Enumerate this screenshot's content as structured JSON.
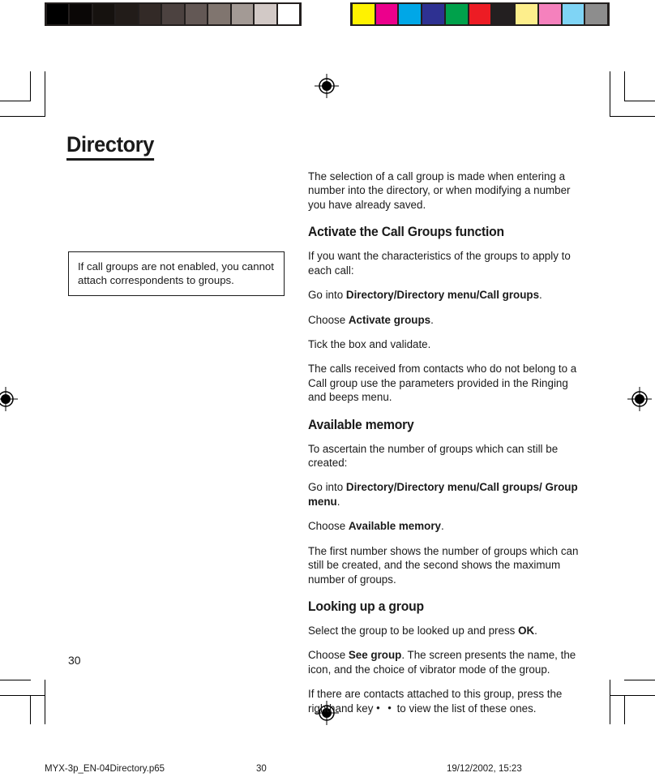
{
  "document": {
    "title": "Directory",
    "page_number": "30"
  },
  "calibration": {
    "grayscale_label": "grayscale-calibration-bar",
    "color_label": "color-calibration-bar",
    "grayscale_swatches": [
      "#000000",
      "#0a0706",
      "#16120f",
      "#221c19",
      "#332a27",
      "#4c4240",
      "#635855",
      "#80756f",
      "#a39a95",
      "#d2c9c6",
      "#ffffff"
    ],
    "color_swatches": [
      "#fff200",
      "#ec008c",
      "#00a7e7",
      "#2e3192",
      "#00a14b",
      "#ed1c24",
      "#231f20",
      "#fdee8c",
      "#f581bd",
      "#7fd4f5",
      "#8d8d8d"
    ]
  },
  "note": {
    "text": "If call groups are not enabled, you cannot attach correspondents to groups."
  },
  "content": {
    "intro": "The selection of a call group is made when entering a number into the directory, or when modifying a number you have already saved.",
    "section1": {
      "heading": "Activate the Call Groups function",
      "p1": "If you want the characteristics of the groups to apply to each call:",
      "p2_prefix": "Go into ",
      "p2_bold": "Directory/Directory menu/Call groups",
      "p2_suffix": ".",
      "p3_prefix": "Choose ",
      "p3_bold": "Activate groups",
      "p3_suffix": ".",
      "p4": "Tick the box and validate.",
      "p5": "The calls received from contacts who do not belong to a Call group use the parameters provided in the Ringing and beeps menu."
    },
    "section2": {
      "heading": "Available memory",
      "p1": "To ascertain the number of groups which can still be created:",
      "p2_prefix": "Go into ",
      "p2_bold": "Directory/Directory menu/Call groups/ Group menu",
      "p2_suffix": ".",
      "p3_prefix": "Choose ",
      "p3_bold": "Available memory",
      "p3_suffix": ".",
      "p4": "The first number shows the number of groups which can still be created, and the second shows the maximum number of groups."
    },
    "section3": {
      "heading": "Looking up a group",
      "p1_prefix": "Select the group to be looked up and press ",
      "p1_bold": "OK",
      "p1_suffix": ".",
      "p2_prefix": "Choose ",
      "p2_bold": "See group",
      "p2_suffix": ". The screen presents the name, the icon, and the choice of  vibrator mode of the group.",
      "p3_prefix": "If there are contacts attached to this group, press the righthand key ",
      "p3_keyglyph": "• •",
      "p3_suffix": " to view the list of these ones."
    }
  },
  "footer": {
    "filename": "MYX-3p_EN-04Directory.p65",
    "page": "30",
    "timestamp": "19/12/2002, 15:23"
  }
}
